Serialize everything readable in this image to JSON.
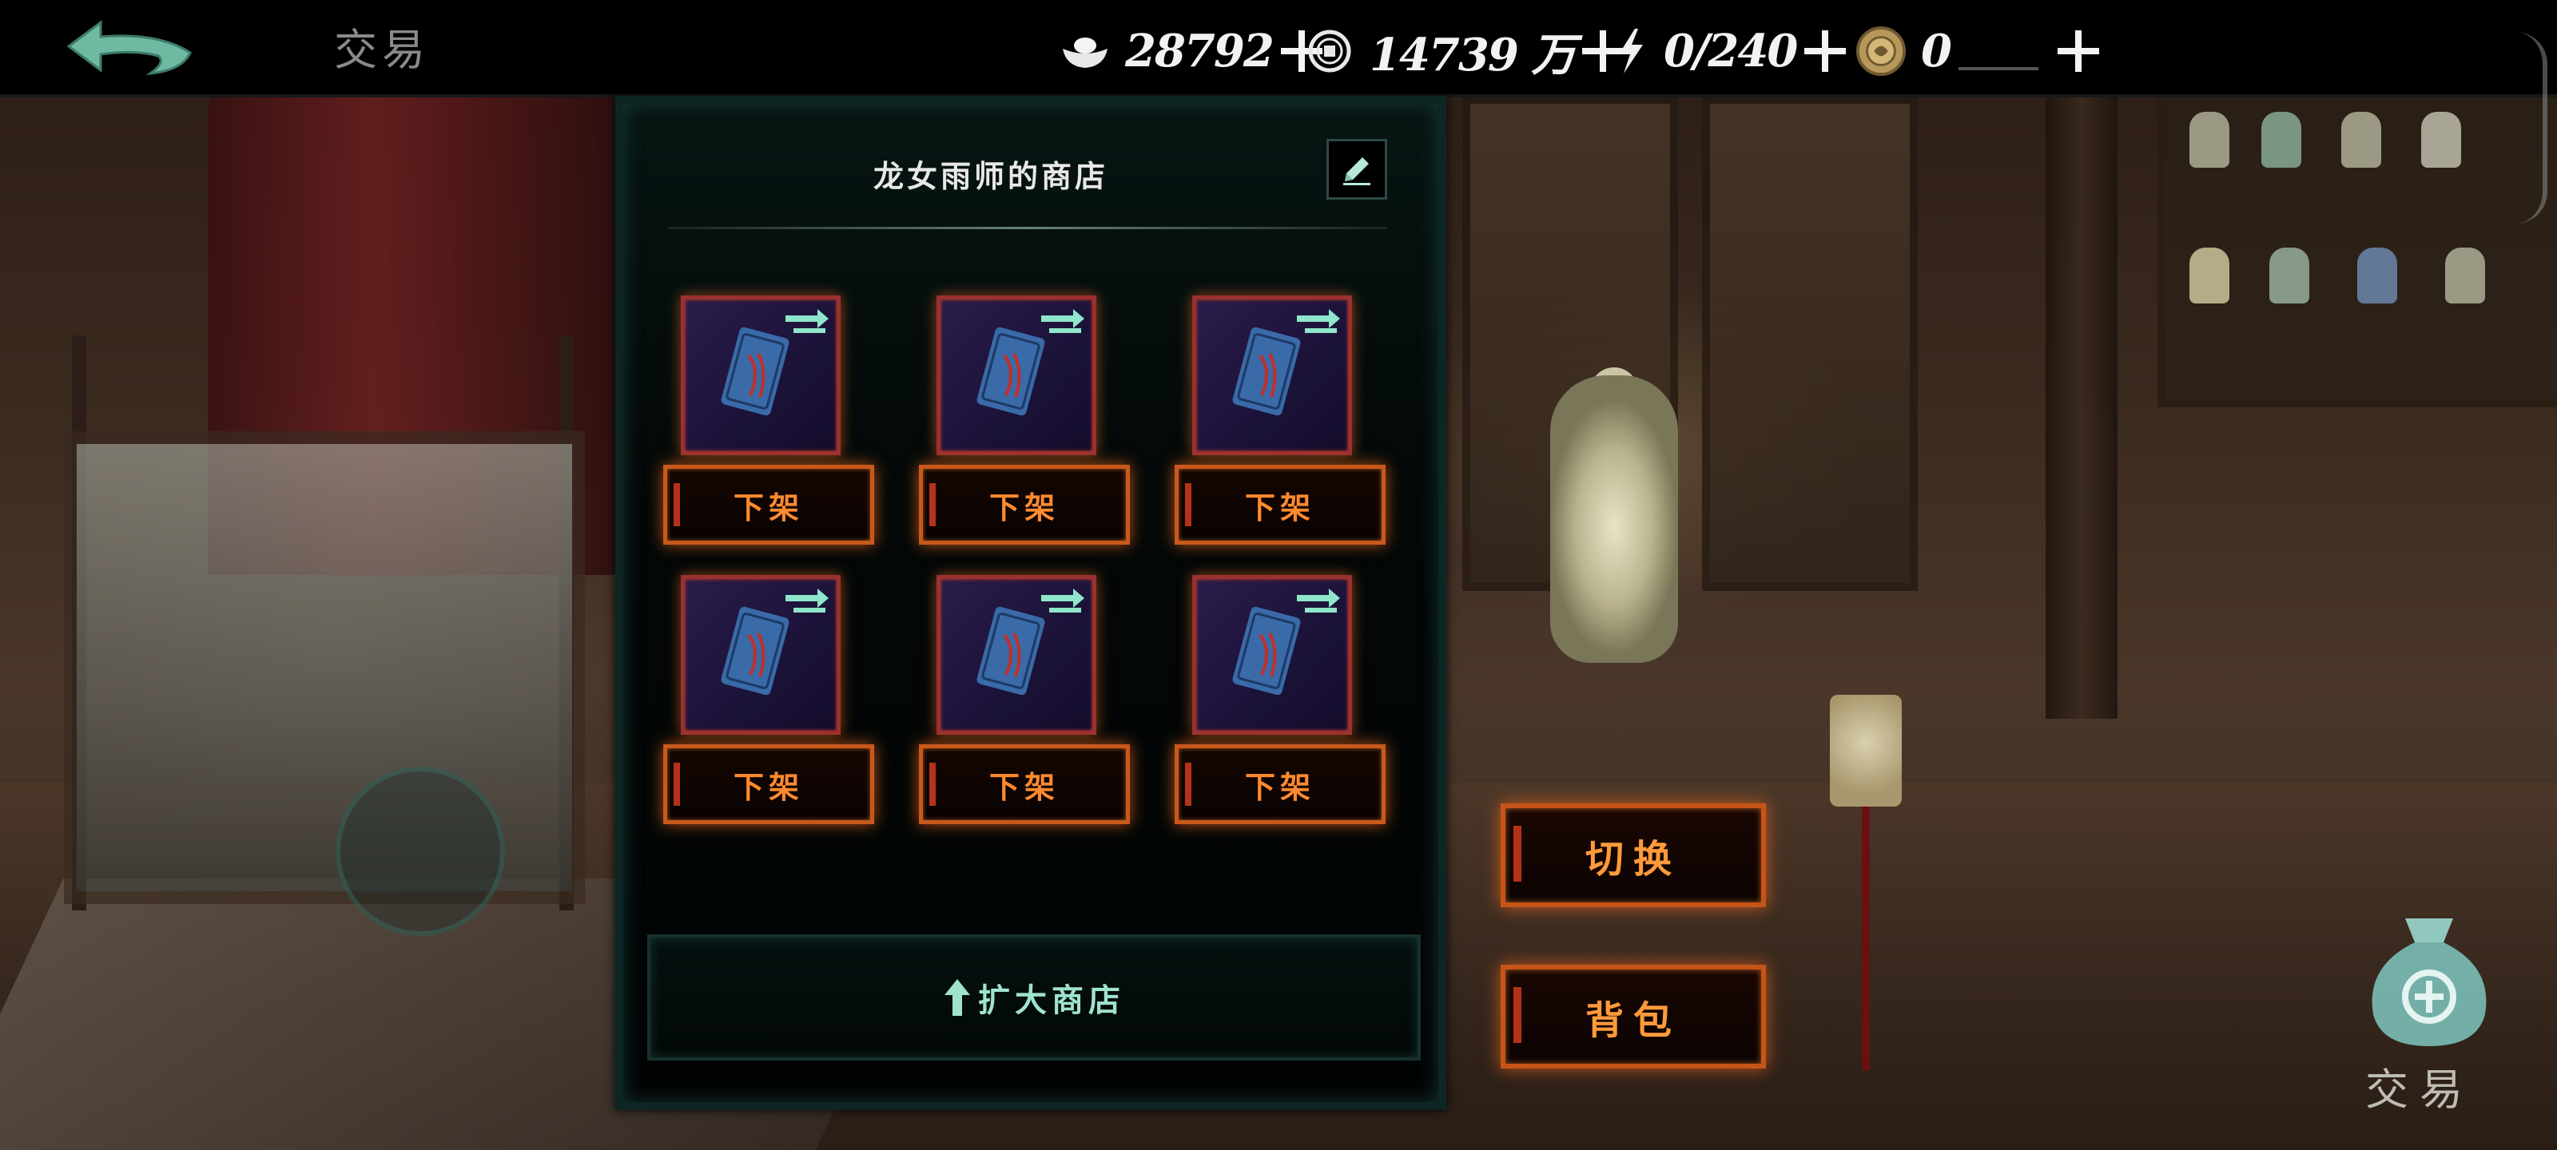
{
  "topbar": {
    "title": "交易",
    "resources": [
      {
        "name": "silver-ingot-icon",
        "value": "28792"
      },
      {
        "name": "copper-coin-icon",
        "value": "14739 万"
      },
      {
        "name": "energy-icon",
        "value": "0/240"
      },
      {
        "name": "gold-medal-icon",
        "value": "0"
      }
    ]
  },
  "shop": {
    "title": "龙女雨师的商店",
    "delist_label": "下架",
    "expand_label": "扩大商店"
  },
  "actions": {
    "switch_label": "切换",
    "backpack_label": "背包"
  },
  "trade": {
    "label": "交易"
  },
  "colors": {
    "accent_orange": "#ff8a30",
    "frame_red": "#9a3030",
    "teal_text": "#9fe3cf",
    "panel_border": "#0d2624"
  }
}
